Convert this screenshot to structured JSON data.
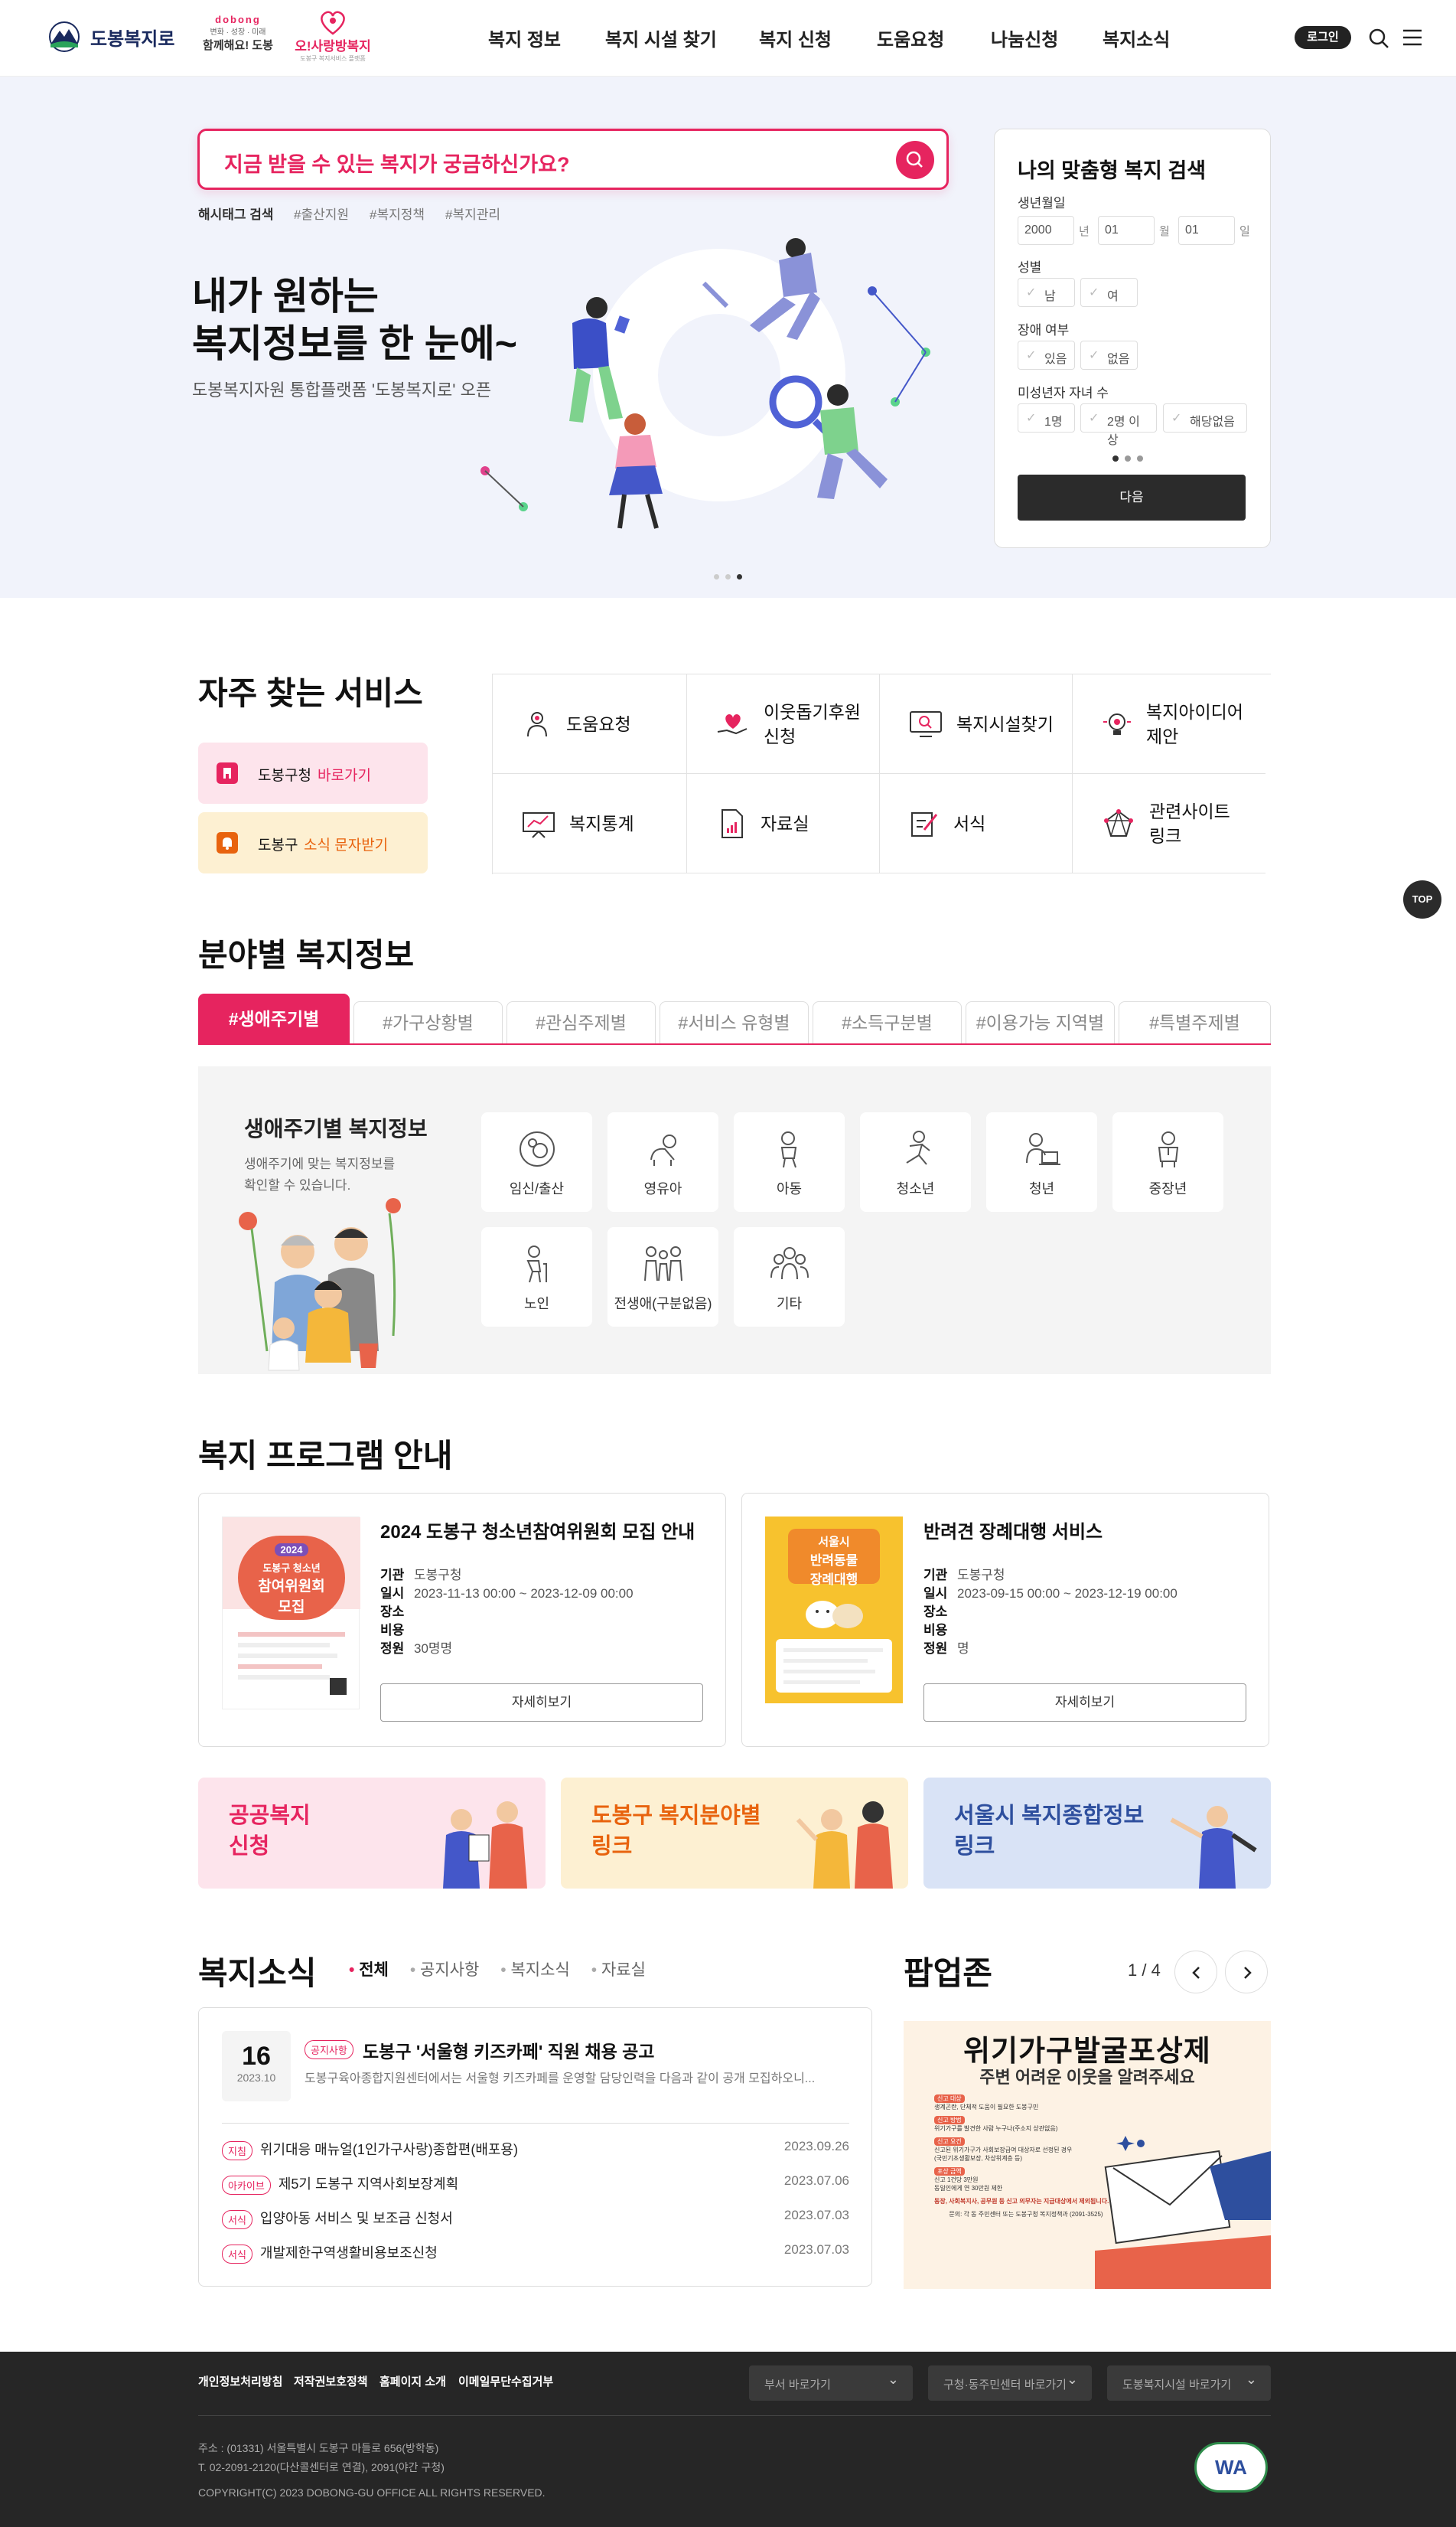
{
  "header": {
    "logo_text": "도봉복지로",
    "sub_logo1_small": "dobong",
    "sub_logo1_mid": "변화 · 성장 · 미래",
    "sub_logo1_main": "함께해요! 도봉",
    "sub_logo2_main": "오!사랑방복지",
    "sub_logo2_small": "도봉구 복지서비스 플랫폼",
    "nav": [
      "복지 정보",
      "복지 시설 찾기",
      "복지 신청",
      "도움요청",
      "나눔신청",
      "복지소식"
    ],
    "login_label": "로그인",
    "colors": {
      "accent": "#e6245f",
      "navy": "#1a2a5e"
    }
  },
  "hero": {
    "search_placeholder": "지금 받을 수 있는 복지가 궁금하신가요?",
    "hashtag_label": "해시태그 검색",
    "hashtags": [
      "#출산지원",
      "#복지정책",
      "#복지관리"
    ],
    "title_line1": "내가 원하는",
    "title_line2": "복지정보를 한 눈에~",
    "subtitle": "도봉복지자원 통합플랫폼 '도봉복지로' 오픈",
    "slide_dots_active": 3
  },
  "custom_search": {
    "title": "나의 맞춤형 복지 검색",
    "birth_label": "생년월일",
    "year": "2000",
    "year_unit": "년",
    "month": "01",
    "month_unit": "월",
    "day": "01",
    "day_unit": "일",
    "gender_label": "성별",
    "gender_options": [
      "남",
      "여"
    ],
    "disability_label": "장애 여부",
    "disability_options": [
      "있음",
      "없음"
    ],
    "children_label": "미성년자 자녀 수",
    "children_options": [
      "1명",
      "2명 이상",
      "해당없음"
    ],
    "next_label": "다음"
  },
  "frequent": {
    "title": "자주 찾는 서비스",
    "quick1_text": "도봉구청",
    "quick1_accent": "바로가기",
    "quick2_text": "도봉구",
    "quick2_accent": "소식 문자받기",
    "services": [
      "도움요청",
      "이웃돕기후원\n신청",
      "복지시설찾기",
      "복지아이디어\n제안",
      "복지통계",
      "자료실",
      "서식",
      "관련사이트\n링크"
    ],
    "top_label": "TOP"
  },
  "field": {
    "title": "분야별 복지정보",
    "tabs": [
      "#생애주기별",
      "#가구상황별",
      "#관심주제별",
      "#서비스 유형별",
      "#소득구분별",
      "#이용가능 지역별",
      "#특별주제별"
    ],
    "panel_title": "생애주기별 복지정보",
    "panel_desc": "생애주기에 맞는 복지정보를\n확인할 수 있습니다.",
    "items": [
      "임신/출산",
      "영유아",
      "아동",
      "청소년",
      "청년",
      "중장년",
      "노인",
      "전생애(구분없음)",
      "기타"
    ]
  },
  "programs": {
    "title": "복지 프로그램 안내",
    "items": [
      {
        "title": "2024 도봉구 청소년참여위원회 모집 안내",
        "org": "도봉구청",
        "period": "2023-11-13 00:00 ~ 2023-12-09 00:00",
        "place": "",
        "cost": "",
        "capacity": "30명명",
        "poster_year": "2024",
        "poster_line1": "도봉구 청소년",
        "poster_line2": "참여위원회",
        "poster_line3": "모집"
      },
      {
        "title": "반려견 장례대행 서비스",
        "org": "도봉구청",
        "period": "2023-09-15 00:00 ~ 2023-12-19 00:00",
        "place": "",
        "cost": "",
        "capacity": "명",
        "poster_line1": "서울시",
        "poster_line2": "반려동물",
        "poster_line3": "장례대행"
      }
    ],
    "labels": {
      "org": "기관",
      "period": "일시",
      "place": "장소",
      "cost": "비용",
      "capacity": "정원"
    },
    "more_label": "자세히보기"
  },
  "banners": [
    {
      "text": "공공복지\n신청",
      "color": "#e6245f",
      "bg": "#fde4ec"
    },
    {
      "text": "도봉구 복지분야별\n링크",
      "color": "#e8630e",
      "bg": "#fdf0d2"
    },
    {
      "text": "서울시 복지종합정보\n링크",
      "color": "#2e4f9e",
      "bg": "#d9e3f6"
    }
  ],
  "news": {
    "title": "복지소식",
    "tabs": [
      "전체",
      "공지사항",
      "복지소식",
      "자료실"
    ],
    "featured": {
      "day": "16",
      "ym": "2023.10",
      "badge": "공지사항",
      "title": "도봉구 '서울형 키즈카페' 직원 채용 공고",
      "summary": "도봉구육아종합지원센터에서는 서울형 키즈카페를 운영할 담당인력을 다음과 같이 공개 모집하오니..."
    },
    "rows": [
      {
        "badge": "지침",
        "title": "위기대응 매뉴얼(1인가구사랑)종합편(배포용)",
        "date": "2023.09.26"
      },
      {
        "badge": "아카이브",
        "title": "제5기 도봉구 지역사회보장계획",
        "date": "2023.07.06"
      },
      {
        "badge": "서식",
        "title": "입양아동 서비스 및 보조금 신청서",
        "date": "2023.07.03"
      },
      {
        "badge": "서식",
        "title": "개발제한구역생활비용보조신청",
        "date": "2023.07.03"
      }
    ]
  },
  "popup": {
    "title": "팝업존",
    "counter": "1 / 4",
    "poster_title": "위기가구발굴포상제",
    "poster_sub": "주변 어려운 이웃을 알려주세요",
    "poster_lines": [
      "신고 대상",
      "생계곤란, 단체적 도움이 필요한 도봉구민",
      "신고 방법",
      "위기가구를 발견한 사람 누구나(주소지 상관없음)",
      "신고 요건",
      "신고된 위기가구가 사회보장급여 대상자로 선정된 경우",
      "(국민기초생활보장, 차상위계층 등)",
      "포상 금액",
      "신고 1건당 3만원",
      "동일인에게 연 30만원 제한"
    ],
    "poster_note": "동장, 사회복지사, 공무원 등 신고 의무자는 지급대상에서 제외됩니다.",
    "poster_contact": "문의: 각 동 주민센터 또는 도봉구청 복지정책과 (2091-3525)"
  },
  "footer": {
    "links": [
      "개인정보처리방침",
      "저작권보호정책",
      "홈페이지 소개",
      "이메일무단수집거부"
    ],
    "selects": [
      "부서 바로가기",
      "구청·동주민센터 바로가기",
      "도봉복지시설 바로가기"
    ],
    "address": "주소 : (01331) 서울특별시 도봉구 마들로 656(방학동)",
    "tel": "T. 02-2091-2120(다산콜센터로 연결), 2091(야간 구청)",
    "copyright": "COPYRIGHT(C) 2023 DOBONG-GU OFFICE ALL RIGHTS RESERVED.",
    "wa_mark": "WA"
  }
}
